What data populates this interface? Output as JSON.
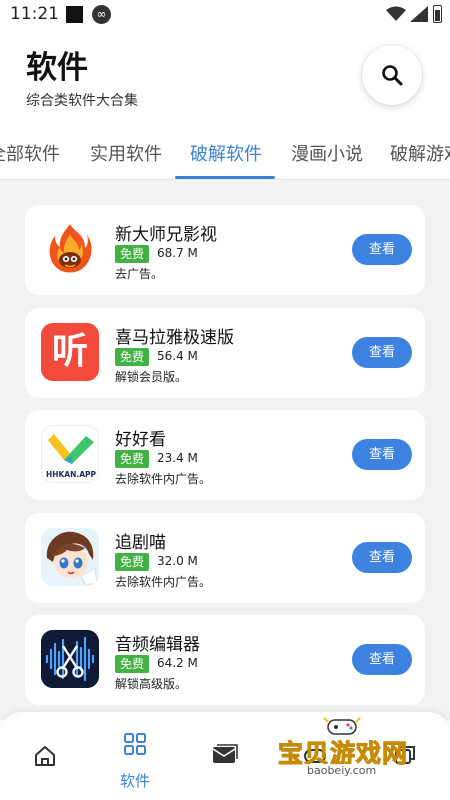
{
  "status_bar": {
    "time": "11:21"
  },
  "header": {
    "title": "软件",
    "subtitle": "综合类软件大合集"
  },
  "tabs": [
    {
      "label": "全部软件"
    },
    {
      "label": "实用软件"
    },
    {
      "label": "破解软件",
      "active": true
    },
    {
      "label": "漫画小说"
    },
    {
      "label": "破解游戏"
    }
  ],
  "apps": [
    {
      "name": "新大师兄影视",
      "badge": "免费",
      "size": "68.7 M",
      "desc": "去广告。",
      "button": "查看",
      "icon": "flame-monkey-icon"
    },
    {
      "name": "喜马拉雅极速版",
      "badge": "免费",
      "size": "56.4 M",
      "desc": "解锁会员版。",
      "button": "查看",
      "icon": "listen-icon",
      "icon_char": "听"
    },
    {
      "name": "好好看",
      "badge": "免费",
      "size": "23.4 M",
      "desc": "去除软件内广告。",
      "button": "查看",
      "icon": "hhkan-icon",
      "icon_text": "HHKAN.APP"
    },
    {
      "name": "追剧喵",
      "badge": "免费",
      "size": "32.0 M",
      "desc": "去除软件内广告。",
      "button": "查看",
      "icon": "anime-character-icon"
    },
    {
      "name": "音频编辑器",
      "badge": "免费",
      "size": "64.2 M",
      "desc": "解锁高级版。",
      "button": "查看",
      "icon": "audio-scissors-icon"
    }
  ],
  "bottom_nav": {
    "active_label": "软件"
  },
  "watermark": {
    "text": "宝贝游戏网",
    "url": "baobeiy.com"
  },
  "colors": {
    "accent": "#3b82d6",
    "badge_green": "#43b244",
    "button_blue": "#3d82e0",
    "list_bg": "#f2f2f2"
  }
}
